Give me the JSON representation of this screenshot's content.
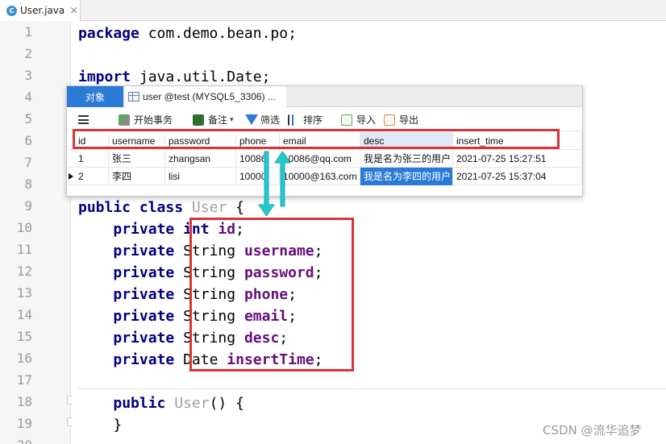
{
  "file_tab": {
    "name": "User.java",
    "icon": "C",
    "close": "×"
  },
  "line_numbers": [
    "1",
    "2",
    "3",
    "4",
    "5",
    "6",
    "7",
    "8",
    "9",
    "10",
    "11",
    "12",
    "13",
    "14",
    "15",
    "16",
    "17",
    "18",
    "19",
    "20"
  ],
  "code": {
    "l1_kw": "package",
    "l1_rest": " com.demo.bean.po;",
    "l3_kw": "import",
    "l3_rest": " java.util.Date;",
    "l9_kw1": "public",
    "l9_kw2": " class",
    "l9_name": " User",
    "l9_brace": " {",
    "private": "private",
    "l10_type": "int",
    "l10_field": "id",
    "l10_end": ";",
    "l11_type": "String",
    "l11_field": "username",
    "l11_end": ";",
    "l12_type": "String",
    "l12_field": "password",
    "l12_end": ";",
    "l13_type": "String",
    "l13_field": "phone",
    "l13_end": ";",
    "l14_type": "String",
    "l14_field": "email",
    "l14_end": ";",
    "l15_type": "String",
    "l15_field": "desc",
    "l15_end": ";",
    "l16_type": "Date",
    "l16_field": "insertTime",
    "l16_end": ";",
    "l18_kw": "public",
    "l18_name": " User",
    "l18_rest": "() {",
    "l19": "}"
  },
  "navicat": {
    "tab_objects": "对象",
    "tab_table": "user @test (MYSQL5_3306) ...",
    "toolbar": {
      "begin": "开始事务",
      "note": "备注",
      "filter": "筛选",
      "sort": "排序",
      "import": "导入",
      "export": "导出"
    },
    "columns": [
      "id",
      "username",
      "password",
      "phone",
      "email",
      "desc",
      "insert_time"
    ],
    "rows": [
      [
        "1",
        "张三",
        "zhangsan",
        "10086",
        "10086@qq.com",
        "我是名为张三的用户",
        "2021-07-25 15:27:51"
      ],
      [
        "2",
        "李四",
        "lisi",
        "10000",
        "10000@163.com",
        "我是名为李四的用户",
        "2021-07-25 15:37:04"
      ]
    ]
  },
  "colors": {
    "highlight_box": "#d9343a",
    "arrow": "#22c9cc",
    "selected_cell": "#2b7bd6"
  },
  "watermark": "CSDN @流华追梦"
}
